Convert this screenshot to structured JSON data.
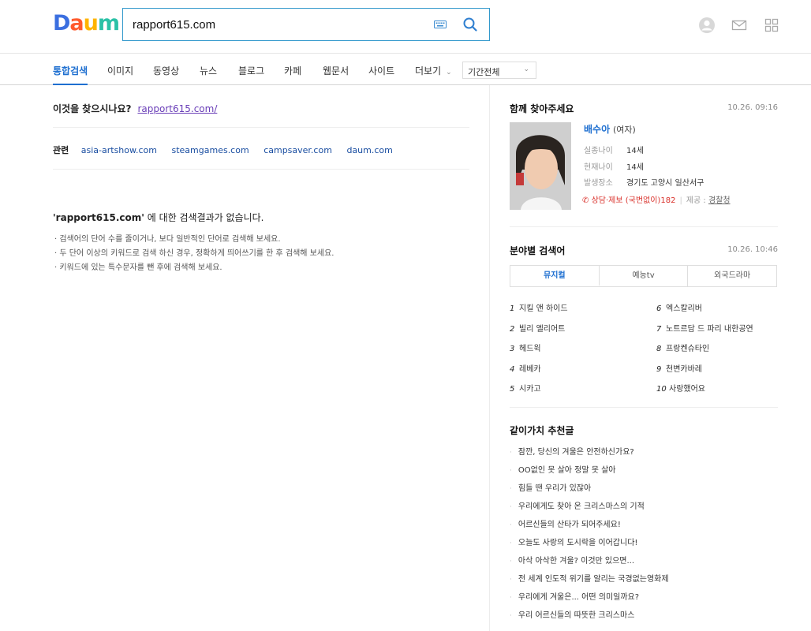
{
  "colors": {
    "accent": "#1e6fd0",
    "search_border": "#3399cc",
    "alert": "#d9302a",
    "visited_link": "#6a3fb8"
  },
  "header": {
    "logo": {
      "letters": [
        "D",
        "a",
        "u",
        "m"
      ],
      "colors": [
        "#3b6fe0",
        "#ff5a2d",
        "#ffb400",
        "#2ac1a6"
      ]
    },
    "search_value": "rapport615.com",
    "icons": [
      "keyboard-icon",
      "search-icon",
      "user-icon",
      "mail-icon",
      "apps-grid-icon"
    ]
  },
  "tabs": [
    {
      "label": "통합검색",
      "active": true
    },
    {
      "label": "이미지"
    },
    {
      "label": "동영상"
    },
    {
      "label": "뉴스"
    },
    {
      "label": "블로그"
    },
    {
      "label": "카페"
    },
    {
      "label": "웹문서"
    },
    {
      "label": "사이트"
    },
    {
      "label": "더보기"
    }
  ],
  "period_select": "기간전체",
  "main": {
    "suggestion_question": "이것을 찾으시나요?",
    "suggestion_link": "rapport615.com/",
    "related_label": "관련",
    "related_links": [
      "asia-artshow.com",
      "steamgames.com",
      "campsaver.com",
      "daum.com"
    ],
    "no_result_keyword": "'rapport615.com'",
    "no_result_text": " 에 대한 검색결과가 없습니다.",
    "tips": [
      "· 검색어의 단어 수를 줄이거나, 보다 일반적인 단어로 검색해 보세요.",
      "· 두 단어 이상의 키워드로 검색 하신 경우, 정확하게 띄어쓰기를 한 후 검색해 보세요.",
      "· 키워드에 있는 특수문자를 뺀 후에 검색해 보세요."
    ]
  },
  "missing": {
    "title": "함께 찾아주세요",
    "time": "10.26. 09:16",
    "name": "배수아",
    "gender": "(여자)",
    "rows": [
      {
        "key": "실종나이",
        "value": "14세"
      },
      {
        "key": "현재나이",
        "value": "14세"
      },
      {
        "key": "발생장소",
        "value": "경기도 고양시 일산서구"
      }
    ],
    "report": "상담·제보 (국번없이)182",
    "source_label": "제공 :",
    "source": "경찰청"
  },
  "category": {
    "title": "분야별 검색어",
    "time": "10.26. 10:46",
    "tabs": [
      {
        "label": "뮤지컬",
        "active": true
      },
      {
        "label": "예능tv"
      },
      {
        "label": "외국드라마"
      }
    ],
    "ranks": [
      {
        "num": "1",
        "label": "지킬 앤 하이드"
      },
      {
        "num": "2",
        "label": "빌리 엘리어트"
      },
      {
        "num": "3",
        "label": "헤드윅"
      },
      {
        "num": "4",
        "label": "레베카"
      },
      {
        "num": "5",
        "label": "시카고"
      },
      {
        "num": "6",
        "label": "엑스칼리버"
      },
      {
        "num": "7",
        "label": "노트르담 드 파리 내한공연"
      },
      {
        "num": "8",
        "label": "프랑켄슈타인"
      },
      {
        "num": "9",
        "label": "천변카바레"
      },
      {
        "num": "10",
        "label": "사랑했어요"
      }
    ]
  },
  "recommend": {
    "title": "같이가치 추천글",
    "items": [
      "잠깐, 당신의 겨울은 안전하신가요?",
      "OO없인 못 살아 정말 못 살아",
      "힘들 땐 우리가 있잖아",
      "우리에게도 찾아 온 크리스마스의 기적",
      "어르신들의 산타가 되어주세요!",
      "오늘도 사랑의 도시락을 이어갑니다!",
      "아삭 아삭한 겨울? 이것만 있으면...",
      "전 세계 인도적 위기를 알리는 국경없는영화제",
      "우리에게 겨울은... 어떤 의미일까요?",
      "우리 어르신들의 따뜻한 크리스마스"
    ]
  }
}
